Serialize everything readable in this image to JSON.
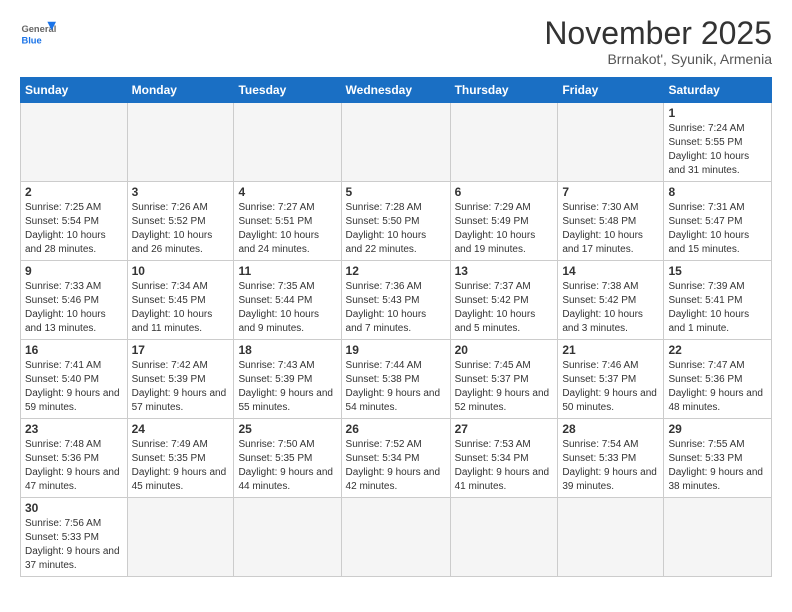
{
  "header": {
    "logo_general": "General",
    "logo_blue": "Blue",
    "title": "November 2025",
    "subtitle": "Brrnakot', Syunik, Armenia"
  },
  "weekdays": [
    "Sunday",
    "Monday",
    "Tuesday",
    "Wednesday",
    "Thursday",
    "Friday",
    "Saturday"
  ],
  "weeks": [
    [
      {
        "day": "",
        "info": "",
        "empty": true
      },
      {
        "day": "",
        "info": "",
        "empty": true
      },
      {
        "day": "",
        "info": "",
        "empty": true
      },
      {
        "day": "",
        "info": "",
        "empty": true
      },
      {
        "day": "",
        "info": "",
        "empty": true
      },
      {
        "day": "",
        "info": "",
        "empty": true
      },
      {
        "day": "1",
        "info": "Sunrise: 7:24 AM\nSunset: 5:55 PM\nDaylight: 10 hours and 31 minutes."
      }
    ],
    [
      {
        "day": "2",
        "info": "Sunrise: 7:25 AM\nSunset: 5:54 PM\nDaylight: 10 hours and 28 minutes."
      },
      {
        "day": "3",
        "info": "Sunrise: 7:26 AM\nSunset: 5:52 PM\nDaylight: 10 hours and 26 minutes."
      },
      {
        "day": "4",
        "info": "Sunrise: 7:27 AM\nSunset: 5:51 PM\nDaylight: 10 hours and 24 minutes."
      },
      {
        "day": "5",
        "info": "Sunrise: 7:28 AM\nSunset: 5:50 PM\nDaylight: 10 hours and 22 minutes."
      },
      {
        "day": "6",
        "info": "Sunrise: 7:29 AM\nSunset: 5:49 PM\nDaylight: 10 hours and 19 minutes."
      },
      {
        "day": "7",
        "info": "Sunrise: 7:30 AM\nSunset: 5:48 PM\nDaylight: 10 hours and 17 minutes."
      },
      {
        "day": "8",
        "info": "Sunrise: 7:31 AM\nSunset: 5:47 PM\nDaylight: 10 hours and 15 minutes."
      }
    ],
    [
      {
        "day": "9",
        "info": "Sunrise: 7:33 AM\nSunset: 5:46 PM\nDaylight: 10 hours and 13 minutes."
      },
      {
        "day": "10",
        "info": "Sunrise: 7:34 AM\nSunset: 5:45 PM\nDaylight: 10 hours and 11 minutes."
      },
      {
        "day": "11",
        "info": "Sunrise: 7:35 AM\nSunset: 5:44 PM\nDaylight: 10 hours and 9 minutes."
      },
      {
        "day": "12",
        "info": "Sunrise: 7:36 AM\nSunset: 5:43 PM\nDaylight: 10 hours and 7 minutes."
      },
      {
        "day": "13",
        "info": "Sunrise: 7:37 AM\nSunset: 5:42 PM\nDaylight: 10 hours and 5 minutes."
      },
      {
        "day": "14",
        "info": "Sunrise: 7:38 AM\nSunset: 5:42 PM\nDaylight: 10 hours and 3 minutes."
      },
      {
        "day": "15",
        "info": "Sunrise: 7:39 AM\nSunset: 5:41 PM\nDaylight: 10 hours and 1 minute."
      }
    ],
    [
      {
        "day": "16",
        "info": "Sunrise: 7:41 AM\nSunset: 5:40 PM\nDaylight: 9 hours and 59 minutes."
      },
      {
        "day": "17",
        "info": "Sunrise: 7:42 AM\nSunset: 5:39 PM\nDaylight: 9 hours and 57 minutes."
      },
      {
        "day": "18",
        "info": "Sunrise: 7:43 AM\nSunset: 5:39 PM\nDaylight: 9 hours and 55 minutes."
      },
      {
        "day": "19",
        "info": "Sunrise: 7:44 AM\nSunset: 5:38 PM\nDaylight: 9 hours and 54 minutes."
      },
      {
        "day": "20",
        "info": "Sunrise: 7:45 AM\nSunset: 5:37 PM\nDaylight: 9 hours and 52 minutes."
      },
      {
        "day": "21",
        "info": "Sunrise: 7:46 AM\nSunset: 5:37 PM\nDaylight: 9 hours and 50 minutes."
      },
      {
        "day": "22",
        "info": "Sunrise: 7:47 AM\nSunset: 5:36 PM\nDaylight: 9 hours and 48 minutes."
      }
    ],
    [
      {
        "day": "23",
        "info": "Sunrise: 7:48 AM\nSunset: 5:36 PM\nDaylight: 9 hours and 47 minutes."
      },
      {
        "day": "24",
        "info": "Sunrise: 7:49 AM\nSunset: 5:35 PM\nDaylight: 9 hours and 45 minutes."
      },
      {
        "day": "25",
        "info": "Sunrise: 7:50 AM\nSunset: 5:35 PM\nDaylight: 9 hours and 44 minutes."
      },
      {
        "day": "26",
        "info": "Sunrise: 7:52 AM\nSunset: 5:34 PM\nDaylight: 9 hours and 42 minutes."
      },
      {
        "day": "27",
        "info": "Sunrise: 7:53 AM\nSunset: 5:34 PM\nDaylight: 9 hours and 41 minutes."
      },
      {
        "day": "28",
        "info": "Sunrise: 7:54 AM\nSunset: 5:33 PM\nDaylight: 9 hours and 39 minutes."
      },
      {
        "day": "29",
        "info": "Sunrise: 7:55 AM\nSunset: 5:33 PM\nDaylight: 9 hours and 38 minutes."
      }
    ],
    [
      {
        "day": "30",
        "info": "Sunrise: 7:56 AM\nSunset: 5:33 PM\nDaylight: 9 hours and 37 minutes.",
        "last": true
      },
      {
        "day": "",
        "info": "",
        "empty": true,
        "last": true
      },
      {
        "day": "",
        "info": "",
        "empty": true,
        "last": true
      },
      {
        "day": "",
        "info": "",
        "empty": true,
        "last": true
      },
      {
        "day": "",
        "info": "",
        "empty": true,
        "last": true
      },
      {
        "day": "",
        "info": "",
        "empty": true,
        "last": true
      },
      {
        "day": "",
        "info": "",
        "empty": true,
        "last": true
      }
    ]
  ]
}
